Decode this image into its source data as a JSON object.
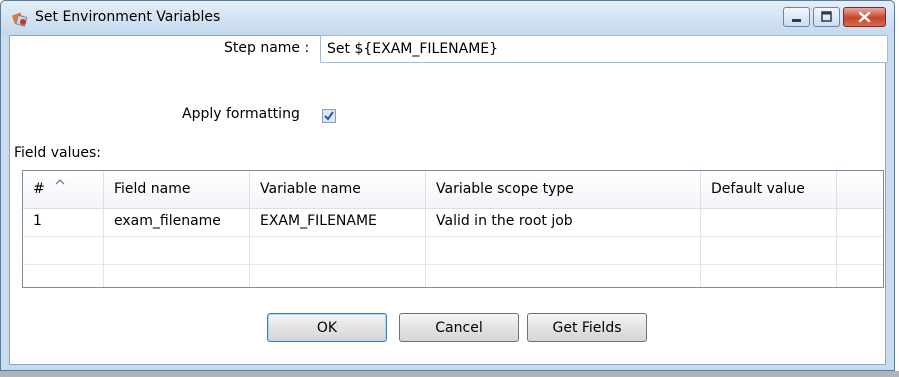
{
  "window": {
    "title": "Set Environment Variables",
    "icon": "kettle-step-icon",
    "controls": [
      "minimize-icon",
      "maximize-icon",
      "close-icon"
    ]
  },
  "form": {
    "step_name_label": "Step name :",
    "step_name_value": "Set ${EXAM_FILENAME}",
    "apply_formatting_label": "Apply formatting",
    "apply_formatting_checked": true,
    "field_values_label": "Field values:"
  },
  "table": {
    "headers": [
      "#",
      "Field name",
      "Variable name",
      "Variable scope type",
      "Default value"
    ],
    "rows": [
      [
        "1",
        "exam_filename",
        "EXAM_FILENAME",
        "Valid in the root job",
        ""
      ]
    ]
  },
  "buttons": {
    "ok": "OK",
    "cancel": "Cancel",
    "get_fields": "Get Fields"
  }
}
